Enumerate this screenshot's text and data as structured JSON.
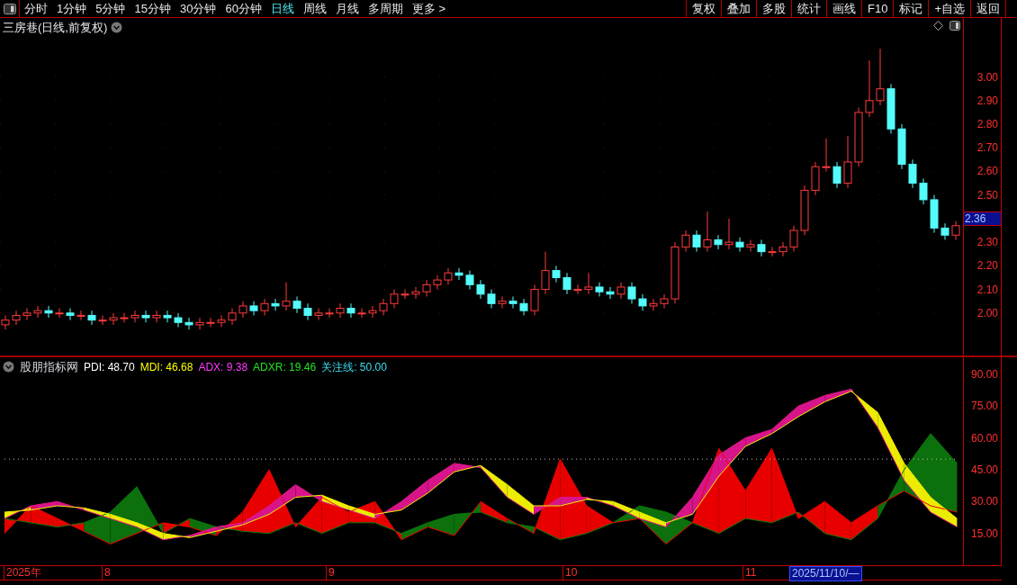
{
  "toolbar": {
    "periods": [
      {
        "label": "分时",
        "selected": false
      },
      {
        "label": "1分钟",
        "selected": false
      },
      {
        "label": "5分钟",
        "selected": false
      },
      {
        "label": "15分钟",
        "selected": false
      },
      {
        "label": "30分钟",
        "selected": false
      },
      {
        "label": "60分钟",
        "selected": false
      },
      {
        "label": "日线",
        "selected": true
      },
      {
        "label": "周线",
        "selected": false
      },
      {
        "label": "月线",
        "selected": false
      },
      {
        "label": "多周期",
        "selected": false
      },
      {
        "label": "更多 >",
        "selected": false
      }
    ],
    "actions": [
      "复权",
      "叠加",
      "多股",
      "统计",
      "画线",
      "F10",
      "标记",
      "+自选",
      "返回"
    ]
  },
  "chart": {
    "title": "三房巷(日线,前复权)",
    "last_price": "2.36",
    "chart_data": {
      "type": "candlestick",
      "grid": true,
      "ylim": [
        1.82,
        3.25
      ],
      "ohlc": [
        [
          1.95,
          1.99,
          1.93,
          1.97
        ],
        [
          1.97,
          2.01,
          1.95,
          1.99
        ],
        [
          1.99,
          2.02,
          1.97,
          2.0
        ],
        [
          2.0,
          2.03,
          1.98,
          2.01
        ],
        [
          2.01,
          2.03,
          1.98,
          2.0
        ],
        [
          2.0,
          2.02,
          1.98,
          2.0
        ],
        [
          2.0,
          2.02,
          1.97,
          1.99
        ],
        [
          1.99,
          2.01,
          1.97,
          1.99
        ],
        [
          1.99,
          2.01,
          1.95,
          1.97
        ],
        [
          1.97,
          1.99,
          1.95,
          1.97
        ],
        [
          1.97,
          2.0,
          1.95,
          1.98
        ],
        [
          1.98,
          2.0,
          1.96,
          1.98
        ],
        [
          1.98,
          2.01,
          1.96,
          1.99
        ],
        [
          1.99,
          2.01,
          1.96,
          1.98
        ],
        [
          1.98,
          2.01,
          1.96,
          1.99
        ],
        [
          1.99,
          2.01,
          1.96,
          1.98
        ],
        [
          1.98,
          2.0,
          1.94,
          1.96
        ],
        [
          1.96,
          1.98,
          1.93,
          1.95
        ],
        [
          1.95,
          1.98,
          1.93,
          1.96
        ],
        [
          1.96,
          1.98,
          1.94,
          1.96
        ],
        [
          1.96,
          1.99,
          1.94,
          1.97
        ],
        [
          1.97,
          2.02,
          1.95,
          2.0
        ],
        [
          2.0,
          2.05,
          1.98,
          2.03
        ],
        [
          2.03,
          2.05,
          1.99,
          2.01
        ],
        [
          2.01,
          2.06,
          1.99,
          2.04
        ],
        [
          2.04,
          2.06,
          2.01,
          2.03
        ],
        [
          2.03,
          2.13,
          2.01,
          2.05
        ],
        [
          2.05,
          2.07,
          2.0,
          2.02
        ],
        [
          2.02,
          2.04,
          1.97,
          1.99
        ],
        [
          1.99,
          2.02,
          1.97,
          2.0
        ],
        [
          2.0,
          2.02,
          1.98,
          2.0
        ],
        [
          2.0,
          2.04,
          1.98,
          2.02
        ],
        [
          2.02,
          2.04,
          1.98,
          2.0
        ],
        [
          2.0,
          2.02,
          1.98,
          2.0
        ],
        [
          2.0,
          2.03,
          1.98,
          2.01
        ],
        [
          2.01,
          2.06,
          1.99,
          2.04
        ],
        [
          2.04,
          2.1,
          2.02,
          2.08
        ],
        [
          2.08,
          2.1,
          2.06,
          2.08
        ],
        [
          2.08,
          2.11,
          2.06,
          2.09
        ],
        [
          2.09,
          2.14,
          2.07,
          2.12
        ],
        [
          2.12,
          2.16,
          2.1,
          2.14
        ],
        [
          2.14,
          2.19,
          2.12,
          2.17
        ],
        [
          2.17,
          2.19,
          2.14,
          2.16
        ],
        [
          2.16,
          2.18,
          2.1,
          2.12
        ],
        [
          2.12,
          2.14,
          2.06,
          2.08
        ],
        [
          2.08,
          2.1,
          2.02,
          2.04
        ],
        [
          2.04,
          2.07,
          2.02,
          2.05
        ],
        [
          2.05,
          2.07,
          2.02,
          2.04
        ],
        [
          2.04,
          2.06,
          1.99,
          2.01
        ],
        [
          2.01,
          2.12,
          1.99,
          2.1
        ],
        [
          2.1,
          2.26,
          2.08,
          2.18
        ],
        [
          2.18,
          2.2,
          2.13,
          2.15
        ],
        [
          2.15,
          2.17,
          2.08,
          2.1
        ],
        [
          2.1,
          2.12,
          2.08,
          2.1
        ],
        [
          2.1,
          2.17,
          2.08,
          2.11
        ],
        [
          2.11,
          2.13,
          2.07,
          2.09
        ],
        [
          2.09,
          2.11,
          2.06,
          2.08
        ],
        [
          2.08,
          2.13,
          2.06,
          2.11
        ],
        [
          2.11,
          2.13,
          2.04,
          2.06
        ],
        [
          2.06,
          2.08,
          2.01,
          2.03
        ],
        [
          2.03,
          2.06,
          2.01,
          2.04
        ],
        [
          2.04,
          2.08,
          2.02,
          2.06
        ],
        [
          2.06,
          2.3,
          2.04,
          2.28
        ],
        [
          2.28,
          2.35,
          2.26,
          2.33
        ],
        [
          2.33,
          2.35,
          2.26,
          2.28
        ],
        [
          2.28,
          2.43,
          2.26,
          2.31
        ],
        [
          2.31,
          2.33,
          2.27,
          2.29
        ],
        [
          2.29,
          2.4,
          2.27,
          2.3
        ],
        [
          2.3,
          2.32,
          2.26,
          2.28
        ],
        [
          2.28,
          2.31,
          2.26,
          2.29
        ],
        [
          2.29,
          2.31,
          2.24,
          2.26
        ],
        [
          2.26,
          2.28,
          2.24,
          2.26
        ],
        [
          2.26,
          2.3,
          2.24,
          2.28
        ],
        [
          2.28,
          2.37,
          2.26,
          2.35
        ],
        [
          2.35,
          2.54,
          2.33,
          2.52
        ],
        [
          2.52,
          2.64,
          2.5,
          2.62
        ],
        [
          2.62,
          2.74,
          2.6,
          2.62
        ],
        [
          2.62,
          2.64,
          2.53,
          2.55
        ],
        [
          2.55,
          2.75,
          2.53,
          2.64
        ],
        [
          2.64,
          2.87,
          2.62,
          2.85
        ],
        [
          2.85,
          3.07,
          2.83,
          2.9
        ],
        [
          2.9,
          3.12,
          2.88,
          2.95
        ],
        [
          2.95,
          2.97,
          2.76,
          2.78
        ],
        [
          2.78,
          2.8,
          2.61,
          2.63
        ],
        [
          2.63,
          2.65,
          2.53,
          2.55
        ],
        [
          2.55,
          2.57,
          2.46,
          2.48
        ],
        [
          2.48,
          2.5,
          2.34,
          2.36
        ],
        [
          2.36,
          2.38,
          2.31,
          2.33
        ],
        [
          2.33,
          2.39,
          2.31,
          2.37
        ]
      ],
      "yticks": [
        {
          "value": 3.0,
          "label": "3.00"
        },
        {
          "value": 2.9,
          "label": "2.90"
        },
        {
          "value": 2.8,
          "label": "2.80"
        },
        {
          "value": 2.7,
          "label": "2.70"
        },
        {
          "value": 2.6,
          "label": "2.60"
        },
        {
          "value": 2.5,
          "label": "2.50"
        },
        {
          "value": 2.3,
          "label": "2.30"
        },
        {
          "value": 2.2,
          "label": "2.20"
        },
        {
          "value": 2.1,
          "label": "2.10"
        },
        {
          "value": 2.0,
          "label": "2.00"
        }
      ]
    }
  },
  "indicator": {
    "name": "股朋指标网",
    "readings": [
      {
        "label": "PDI: 48.70",
        "color": "#ffffff"
      },
      {
        "label": "MDI: 46.68",
        "color": "#ffff00"
      },
      {
        "label": "ADX: 9.38",
        "color": "#ff3cff"
      },
      {
        "label": "ADXR: 19.46",
        "color": "#22e022"
      },
      {
        "label": "关注线: 50.00",
        "color": "#3cdcf0"
      }
    ],
    "chart_data": {
      "type": "line",
      "ylim": [
        0,
        98
      ],
      "series": [
        {
          "color": "#0a7a0a",
          "values": [
            22,
            20,
            18,
            20,
            25,
            37,
            15,
            22,
            18,
            16,
            15,
            20,
            15,
            20,
            20,
            15,
            20,
            24,
            25,
            20,
            18,
            12,
            15,
            20,
            28,
            25,
            20,
            15,
            22,
            20,
            25,
            15,
            12,
            22,
            45,
            62,
            48
          ]
        },
        {
          "color": "#f00000",
          "values": [
            15,
            28,
            22,
            16,
            10,
            15,
            20,
            18,
            14,
            25,
            45,
            18,
            32,
            25,
            30,
            12,
            18,
            14,
            30,
            22,
            15,
            50,
            28,
            20,
            22,
            10,
            20,
            55,
            35,
            55,
            22,
            30,
            20,
            28,
            35,
            28,
            25
          ]
        },
        {
          "color": "#e0168c",
          "values": [
            22,
            28,
            30,
            26,
            22,
            18,
            12,
            14,
            18,
            20,
            28,
            38,
            30,
            26,
            22,
            30,
            40,
            48,
            46,
            32,
            24,
            32,
            32,
            28,
            22,
            18,
            32,
            52,
            60,
            64,
            75,
            80,
            83,
            65,
            40,
            25,
            18
          ]
        },
        {
          "color": "#f0f000",
          "values": [
            25,
            26,
            28,
            27,
            24,
            20,
            15,
            13,
            16,
            19,
            24,
            32,
            33,
            28,
            24,
            26,
            34,
            44,
            47,
            38,
            28,
            28,
            31,
            30,
            25,
            20,
            24,
            42,
            56,
            62,
            70,
            77,
            82,
            72,
            48,
            32,
            22
          ]
        },
        {
          "color": "#bbbbbb",
          "line_style": "dotted",
          "values": [
            50,
            50,
            50,
            50,
            50,
            50,
            50,
            50,
            50,
            50,
            50,
            50,
            50,
            50,
            50,
            50,
            50,
            50,
            50,
            50,
            50,
            50,
            50,
            50,
            50,
            50,
            50,
            50,
            50,
            50,
            50,
            50,
            50,
            50,
            50,
            50,
            50
          ]
        }
      ],
      "yticks": [
        {
          "value": 90,
          "label": "90.00"
        },
        {
          "value": 75,
          "label": "75.00"
        },
        {
          "value": 60,
          "label": "60.00"
        },
        {
          "value": 45,
          "label": "45.00"
        },
        {
          "value": 30,
          "label": "30.00"
        },
        {
          "value": 15,
          "label": "15.00"
        }
      ]
    }
  },
  "date_axis": {
    "labels": [
      "2025年",
      "8",
      "9",
      "10",
      "11"
    ],
    "cursor_date": "2025/11/10/—"
  }
}
